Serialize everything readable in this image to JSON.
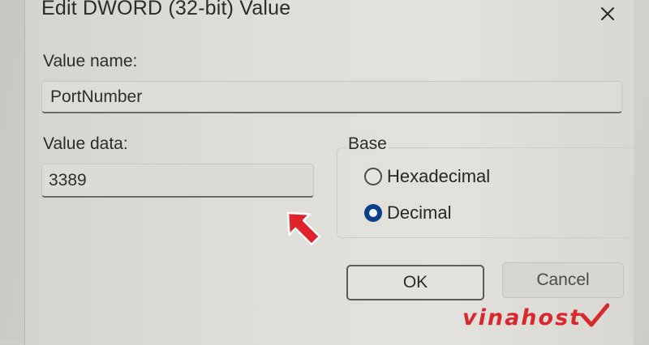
{
  "dialog": {
    "title": "Edit DWORD (32-bit) Value",
    "close_icon": "close-icon",
    "value_name": {
      "label": "Value name:",
      "value": "PortNumber"
    },
    "value_data": {
      "label": "Value data:",
      "value": "3389"
    },
    "base": {
      "legend": "Base",
      "options": [
        {
          "label": "Hexadecimal",
          "selected": false
        },
        {
          "label": "Decimal",
          "selected": true
        }
      ]
    },
    "buttons": {
      "ok": "OK",
      "cancel": "Cancel"
    }
  },
  "annotation": {
    "arrow_icon": "red-arrow-icon",
    "arrow_color": "#e0242b"
  },
  "watermark": {
    "text": "vinahost",
    "color": "#d9272e"
  },
  "colors": {
    "radio_selected": "#0a3f8c",
    "dialog_bg": "#e0ded9"
  }
}
